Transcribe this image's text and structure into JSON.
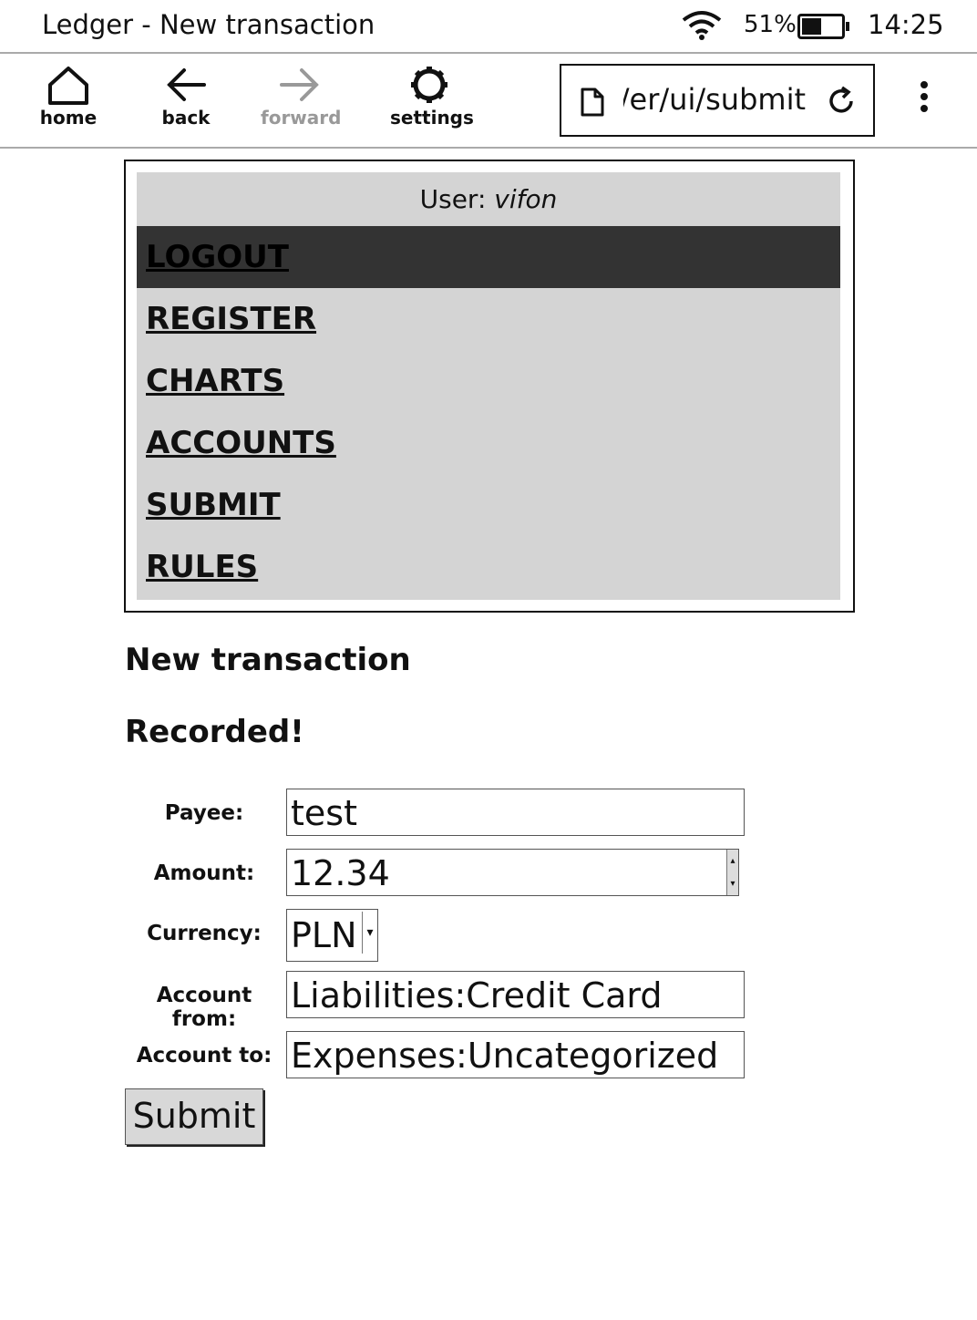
{
  "statusbar": {
    "title": "Ledger - New transaction",
    "battery": "51%",
    "battery_level": 0.51,
    "time": "14:25"
  },
  "toolbar": {
    "home_label": "home",
    "back_label": "back",
    "forward_label": "forward",
    "settings_label": "settings",
    "url": "er/ui/submit/"
  },
  "nav": {
    "user_prefix": "User: ",
    "username": "vifon",
    "items": [
      {
        "label": "LOGOUT"
      },
      {
        "label": "REGISTER"
      },
      {
        "label": "CHARTS"
      },
      {
        "label": "ACCOUNTS"
      },
      {
        "label": "SUBMIT"
      },
      {
        "label": "RULES"
      }
    ]
  },
  "main": {
    "title": "New transaction",
    "status": "Recorded!",
    "form": {
      "payee_label": "Payee:",
      "payee_value": "test",
      "amount_label": "Amount:",
      "amount_value": "12.34",
      "currency_label": "Currency:",
      "currency_value": "PLN",
      "account_from_label": "Account from:",
      "account_from_value": "Liabilities:Credit Card",
      "account_to_label": "Account to:",
      "account_to_value": "Expenses:Uncategorized",
      "submit_label": "Submit"
    }
  }
}
